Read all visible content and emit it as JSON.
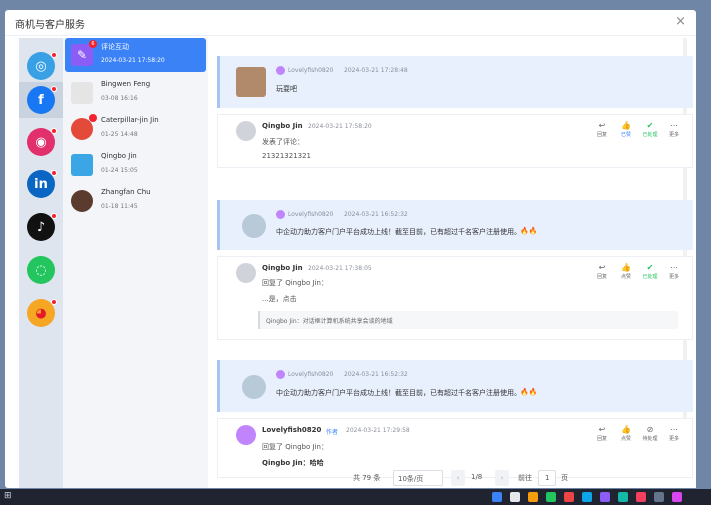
{
  "taskbar": {
    "clock": ""
  },
  "modal": {
    "title": "商机与客户服务",
    "close": "×"
  },
  "platforms": [
    {
      "name": "generic",
      "icon": "globe-icon",
      "color": "#3aa0e6",
      "unread": true
    },
    {
      "name": "facebook",
      "icon": "facebook-icon",
      "color": "#1877f2",
      "unread": true,
      "active": true
    },
    {
      "name": "instagram",
      "icon": "instagram-icon",
      "color": "#e1306c",
      "unread": true
    },
    {
      "name": "linkedin",
      "icon": "linkedin-icon",
      "color": "#0a66c2",
      "unread": true
    },
    {
      "name": "tiktok",
      "icon": "tiktok-icon",
      "color": "#111111",
      "unread": true
    },
    {
      "name": "wechat",
      "icon": "wechat-icon",
      "color": "#22c55e",
      "unread": false
    },
    {
      "name": "weibo",
      "icon": "weibo-icon",
      "color": "#e6162d",
      "unread": true
    }
  ],
  "conversations": [
    {
      "name": "评论互动",
      "time": "2024-03-21 17:58:20",
      "active": true,
      "badge": "6",
      "avatar_color": "#8b5cf6"
    },
    {
      "name": "Bingwen Feng",
      "time": "03-08 16:16",
      "avatar_color": "#d9d9d9"
    },
    {
      "name": "Caterpillar-jin Jin",
      "time": "01-25 14:48",
      "avatar_color": "#e34a3a"
    },
    {
      "name": "Qingbo Jin",
      "time": "01-24 15:05",
      "avatar_color": "#3aa6e6"
    },
    {
      "name": "Zhangfan Chu",
      "time": "01-18 11:45",
      "avatar_color": "#5b3b2e"
    }
  ],
  "threads": [
    {
      "post_author": "Lovelyfish0820",
      "post_time": "2024-03-21 17:28:48",
      "post_text": "玩耍吧",
      "comment": {
        "name": "Qingbo Jin",
        "time": "2024-03-21 17:58:20",
        "line1": "发表了评论：",
        "line2": "21321321321",
        "actions": [
          {
            "icon": "reply-icon",
            "label": "回复"
          },
          {
            "icon": "like-icon",
            "label": "已赞",
            "state": "liked"
          },
          {
            "icon": "check-icon",
            "label": "已处理",
            "state": "done"
          },
          {
            "icon": "more-icon",
            "label": "更多"
          }
        ]
      }
    },
    {
      "post_author": "Lovelyfish0820",
      "post_time": "2024-03-21 16:52:32",
      "post_text": "中企动力助力客户门户平台成功上线！截至目前，已有超过千名客户注册使用。",
      "comment": {
        "name": "Qingbo Jin",
        "time": "2024-03-21 17:38:05",
        "line1": "回复了 Qingbo Jin：",
        "line2": "...是，点击",
        "quote": "Qingbo Jin：对话框计算机系统共享会谈的地域",
        "actions": [
          {
            "icon": "reply-icon",
            "label": "回复"
          },
          {
            "icon": "like-icon",
            "label": "点赞"
          },
          {
            "icon": "check-icon",
            "label": "已处理",
            "state": "done"
          },
          {
            "icon": "more-icon",
            "label": "更多"
          }
        ]
      }
    },
    {
      "post_author": "Lovelyfish0820",
      "post_time": "2024-03-21 16:52:32",
      "post_text": "中企动力助力客户门户平台成功上线！截至目前，已有超过千名客户注册使用。",
      "comment": {
        "name": "Lovelyfish0820",
        "author_tag": "作者",
        "time": "2024-03-21 17:29:58",
        "line1": "回复了 Qingbo Jin：",
        "line2": "Qingbo Jin：哈哈",
        "actions": [
          {
            "icon": "reply-icon",
            "label": "回复"
          },
          {
            "icon": "like-icon",
            "label": "点赞"
          },
          {
            "icon": "pending-icon",
            "label": "待处理"
          },
          {
            "icon": "more-icon",
            "label": "更多"
          }
        ]
      }
    }
  ],
  "pagination": {
    "total": "共 79 条",
    "page_size": "10条/页",
    "prev": "‹",
    "page_of": "1/8",
    "next": "›",
    "goto_label": "前往",
    "goto_value": "1",
    "page_unit": "页"
  }
}
